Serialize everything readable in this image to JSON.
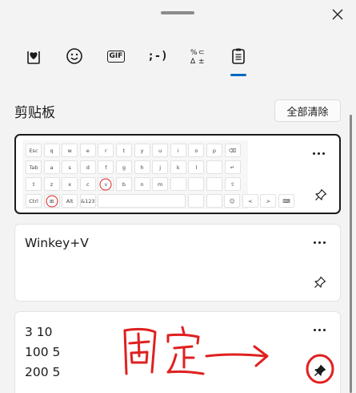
{
  "tabs": [
    {
      "name": "favorites",
      "icon": "heart-box-icon"
    },
    {
      "name": "emoji",
      "icon": "smiley-icon"
    },
    {
      "name": "gif",
      "icon": "gif-icon",
      "label": "GIF"
    },
    {
      "name": "kaomoji",
      "icon": "kaomoji-icon",
      "label": ";-)"
    },
    {
      "name": "symbols",
      "icon": "symbols-icon"
    },
    {
      "name": "clipboard",
      "icon": "clipboard-icon",
      "selected": true
    }
  ],
  "clipboard": {
    "title": "剪贴板",
    "clear_all_label": "全部清除"
  },
  "items": [
    {
      "type": "image",
      "content": "keyboard-screenshot",
      "selected": true,
      "pinned": false
    },
    {
      "type": "text",
      "text": "Winkey+V",
      "pinned": false
    },
    {
      "type": "text",
      "lines": [
        "3 10",
        "100 5",
        "200 5"
      ],
      "pinned": true
    }
  ],
  "keyboard": {
    "row1": [
      "Esc",
      "q",
      "w",
      "e",
      "r",
      "t",
      "y",
      "u",
      "i",
      "o",
      "p",
      "⌫"
    ],
    "row2": [
      "Tab",
      "a",
      "s",
      "d",
      "f",
      "g",
      "h",
      "j",
      "k",
      "l",
      "",
      "↵"
    ],
    "row3": [
      "⇧",
      "z",
      "x",
      "c",
      "v",
      "b",
      "n",
      "m",
      "",
      "",
      "",
      "⇧"
    ],
    "row4": [
      "Ctrl",
      "⊞",
      "Alt",
      "&123",
      "",
      "",
      "",
      "☺",
      "<",
      ">",
      "⌨"
    ]
  },
  "colors": {
    "accent": "#0067c0",
    "annotation": "#e02020"
  }
}
